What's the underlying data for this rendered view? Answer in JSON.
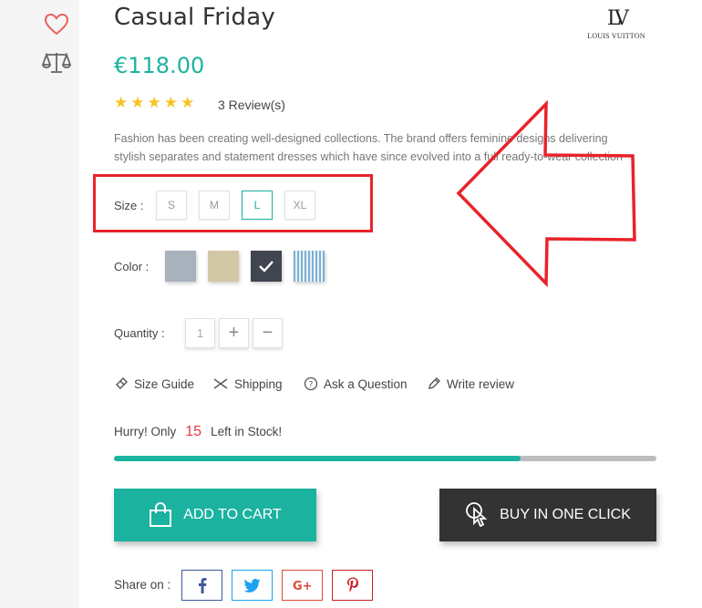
{
  "product": {
    "title": "Casual Friday",
    "price": "€118.00",
    "rating_stars": 5,
    "reviews": "3 Review(s)",
    "description_line1": "Fashion has been creating well-designed collections. The brand offers feminine designs delivering",
    "description_line2": "stylish separates and statement dresses which have since evolved into a full ready-to-wear collection"
  },
  "brand": {
    "mark": "LV",
    "name": "LOUIS VUITTON"
  },
  "rail": {
    "icons": [
      "heart-icon",
      "compare-scale-icon"
    ]
  },
  "size": {
    "label": "Size :",
    "options": [
      "S",
      "M",
      "L",
      "XL"
    ],
    "selected": "L"
  },
  "color": {
    "label": "Color :",
    "options": [
      "#a9b1bd",
      "#d3c8a5",
      "#414550",
      "stripe-blue"
    ],
    "selected_index": 2
  },
  "quantity": {
    "label": "Quantity :",
    "value": "1",
    "plus": "+",
    "minus": "−"
  },
  "links": {
    "size_guide": "Size Guide",
    "shipping": "Shipping",
    "ask": "Ask a Question",
    "review": "Write review"
  },
  "stock": {
    "prefix": "Hurry! Only",
    "count": "15",
    "suffix": "Left in Stock!",
    "progress_fraction": 0.75
  },
  "buttons": {
    "add_to_cart": "ADD TO CART",
    "buy_one_click": "BUY IN ONE CLICK"
  },
  "share": {
    "label": "Share on :",
    "networks": [
      "facebook",
      "twitter",
      "google-plus",
      "pinterest"
    ]
  },
  "colors": {
    "accent": "#1bb3a0",
    "dark": "#333333",
    "highlight": "#e8232a",
    "stock_red": "#e4393c"
  }
}
